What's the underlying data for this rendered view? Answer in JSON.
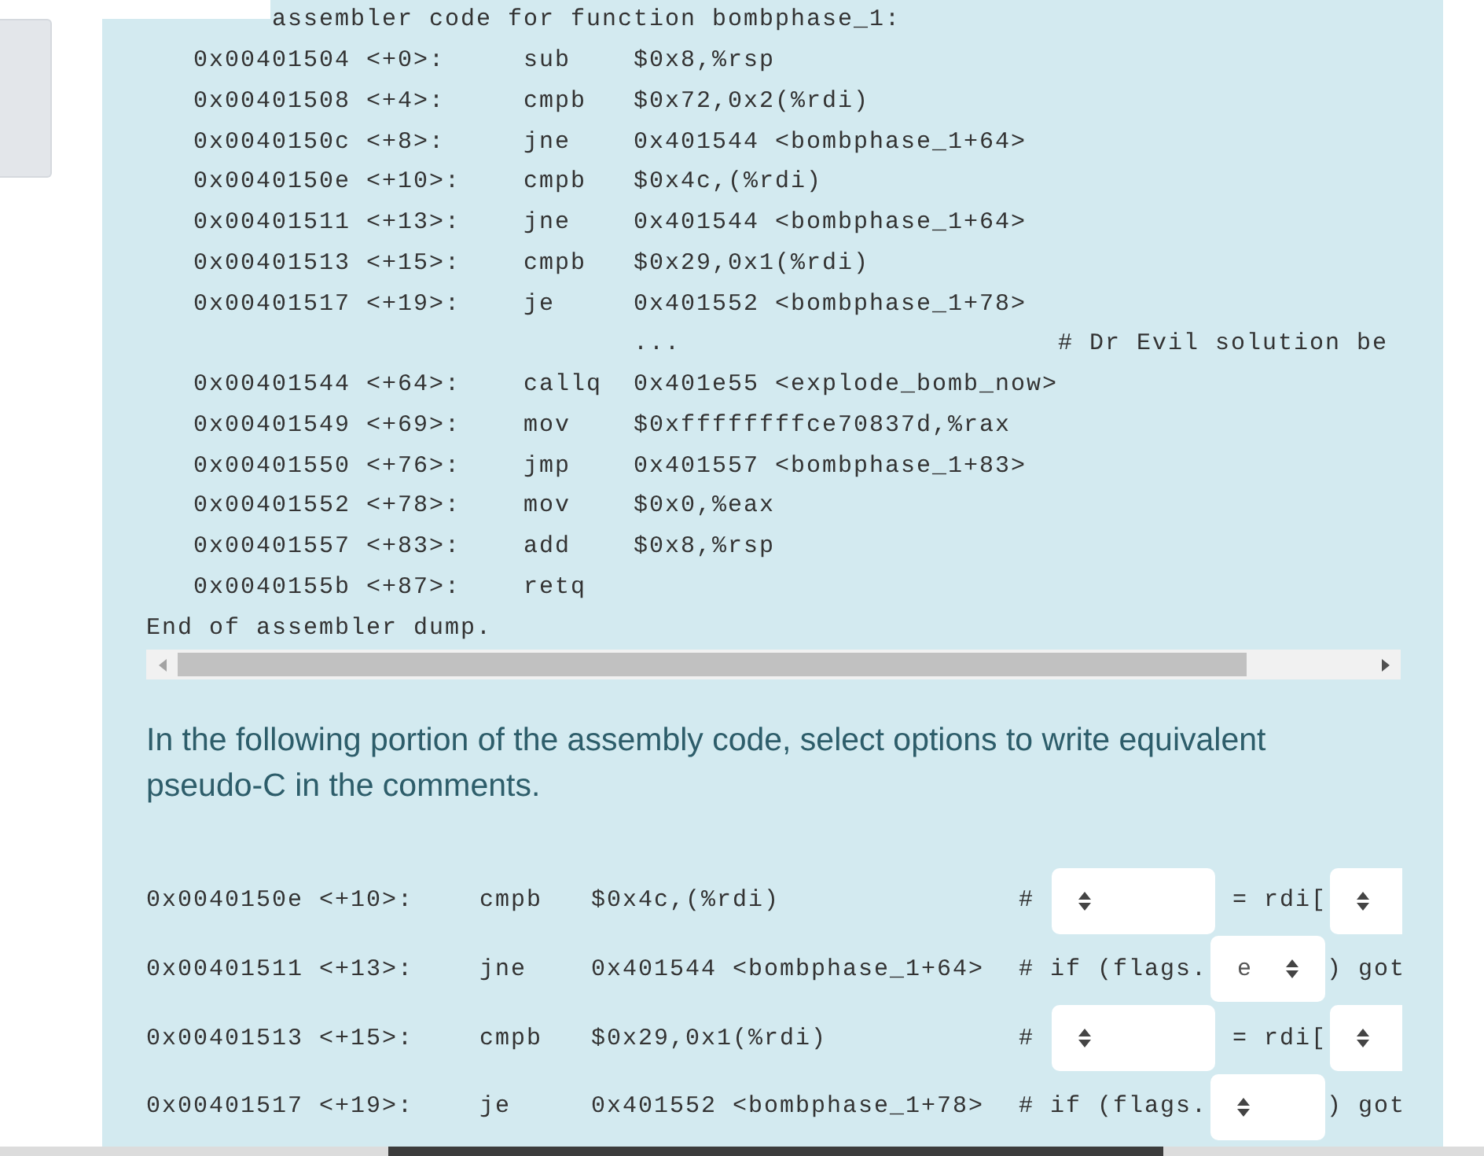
{
  "assembler_dump": {
    "lines": [
      {
        "kind": "cut_heading",
        "text": "assembler code for function bombphase_1:"
      },
      {
        "kind": "instruction",
        "address": "0x00401504 <+0>:",
        "mnemonic": "sub",
        "operands": "$0x8,%rsp"
      },
      {
        "kind": "instruction",
        "address": "0x00401508 <+4>:",
        "mnemonic": "cmpb",
        "operands": "$0x72,0x2(%rdi)"
      },
      {
        "kind": "instruction",
        "address": "0x0040150c <+8>:",
        "mnemonic": "jne",
        "operands": "0x401544 <bombphase_1+64>"
      },
      {
        "kind": "instruction",
        "address": "0x0040150e <+10>:",
        "mnemonic": "cmpb",
        "operands": "$0x4c,(%rdi)"
      },
      {
        "kind": "instruction",
        "address": "0x00401511 <+13>:",
        "mnemonic": "jne",
        "operands": "0x401544 <bombphase_1+64>"
      },
      {
        "kind": "instruction",
        "address": "0x00401513 <+15>:",
        "mnemonic": "cmpb",
        "operands": "$0x29,0x1(%rdi)"
      },
      {
        "kind": "instruction",
        "address": "0x00401517 <+19>:",
        "mnemonic": "je",
        "operands": "0x401552 <bombphase_1+78>"
      },
      {
        "kind": "elision",
        "text": "...",
        "comment": "# Dr Evil solution be"
      },
      {
        "kind": "instruction",
        "address": "0x00401544 <+64>:",
        "mnemonic": "callq",
        "operands": "0x401e55 <explode_bomb_now>"
      },
      {
        "kind": "instruction",
        "address": "0x00401549 <+69>:",
        "mnemonic": "mov",
        "operands": "$0xffffffffce70837d,%rax"
      },
      {
        "kind": "instruction",
        "address": "0x00401550 <+76>:",
        "mnemonic": "jmp",
        "operands": "0x401557 <bombphase_1+83>"
      },
      {
        "kind": "instruction",
        "address": "0x00401552 <+78>:",
        "mnemonic": "mov",
        "operands": "$0x0,%eax"
      },
      {
        "kind": "instruction",
        "address": "0x00401557 <+83>:",
        "mnemonic": "add",
        "operands": "$0x8,%rsp"
      },
      {
        "kind": "instruction",
        "address": "0x0040155b <+87>:",
        "mnemonic": "retq"
      },
      {
        "kind": "text",
        "text": "End of assembler dump."
      }
    ]
  },
  "instructions": "In the following portion of the assembly code, select options to write equivalent pseudo-C in the comments.",
  "exercise": {
    "rows": [
      {
        "address": "0x0040150e <+10>:",
        "mnemonic": "cmpb",
        "operands": "$0x4c,(%rdi)",
        "comment": [
          {
            "kind": "text",
            "text": "#"
          },
          {
            "kind": "operand_select"
          },
          {
            "kind": "text",
            "text": "= rdi["
          },
          {
            "kind": "index_select"
          }
        ]
      },
      {
        "address": "0x00401511 <+13>:",
        "mnemonic": "jne",
        "operands": "0x401544 <bombphase_1+64>",
        "comment": [
          {
            "kind": "text",
            "text": "# if (flags."
          },
          {
            "kind": "flag_select",
            "value": "e"
          },
          {
            "kind": "text",
            "text": ") got"
          }
        ]
      },
      {
        "address": "0x00401513 <+15>:",
        "mnemonic": "cmpb",
        "operands": "$0x29,0x1(%rdi)",
        "comment": [
          {
            "kind": "text",
            "text": "#"
          },
          {
            "kind": "operand_select"
          },
          {
            "kind": "text",
            "text": "= rdi["
          },
          {
            "kind": "index_select"
          }
        ]
      },
      {
        "address": "0x00401517 <+19>:",
        "mnemonic": "je",
        "operands": "0x401552 <bombphase_1+78>",
        "comment": [
          {
            "kind": "text",
            "text": "# if (flags."
          },
          {
            "kind": "flag_select"
          },
          {
            "kind": "text",
            "text": ") got"
          }
        ]
      }
    ]
  }
}
